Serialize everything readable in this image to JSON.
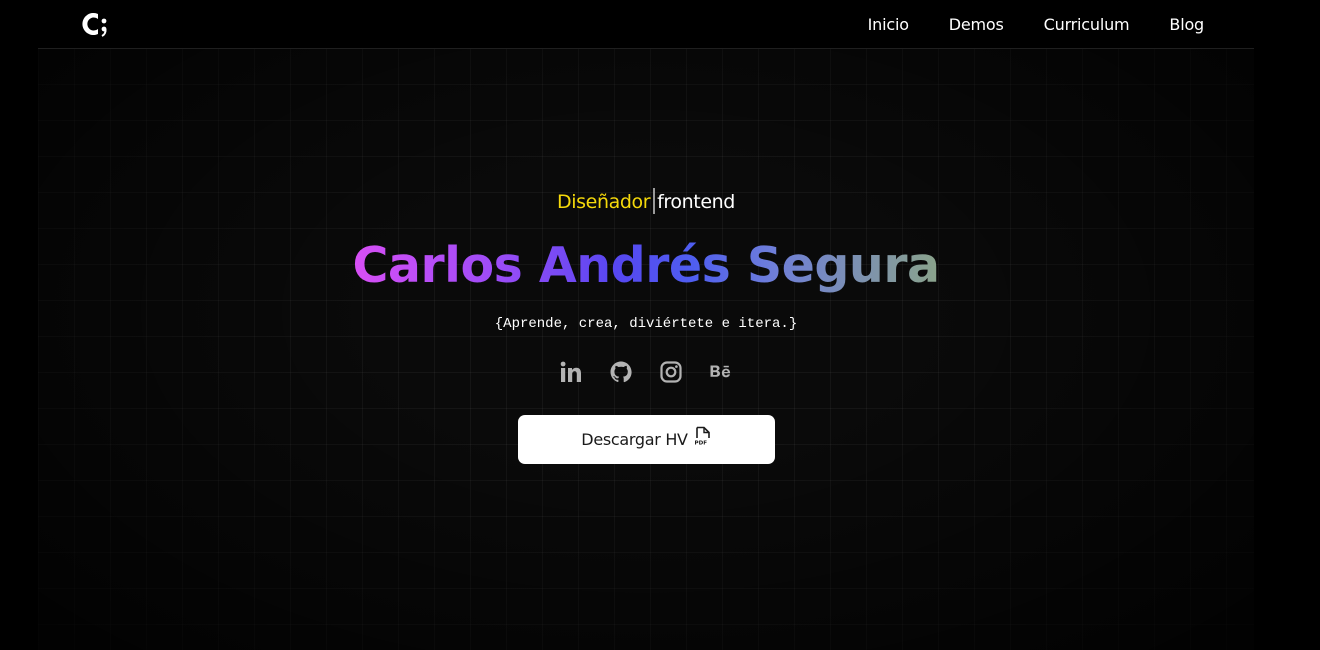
{
  "nav": {
    "logo_icon": "c-semicolon-logo",
    "links": [
      {
        "label": "Inicio"
      },
      {
        "label": "Demos"
      },
      {
        "label": "Curriculum"
      },
      {
        "label": "Blog"
      }
    ]
  },
  "hero": {
    "role_highlight": "Diseñador",
    "role_rest": "frontend",
    "name": "Carlos Andrés Segura",
    "tagline": "{Aprende, crea, diviértete e itera.}",
    "socials": [
      {
        "icon": "linkedin-icon"
      },
      {
        "icon": "github-icon"
      },
      {
        "icon": "instagram-icon"
      },
      {
        "icon": "behance-icon"
      }
    ],
    "cta_label": "Descargar HV",
    "cta_icon": "pdf-file-icon"
  },
  "colors": {
    "background": "#000000",
    "role_highlight": "#f5d90a",
    "name_gradient": [
      "#d84ff5",
      "#5647f0",
      "#8aa38a"
    ],
    "cta_background": "#ffffff"
  }
}
